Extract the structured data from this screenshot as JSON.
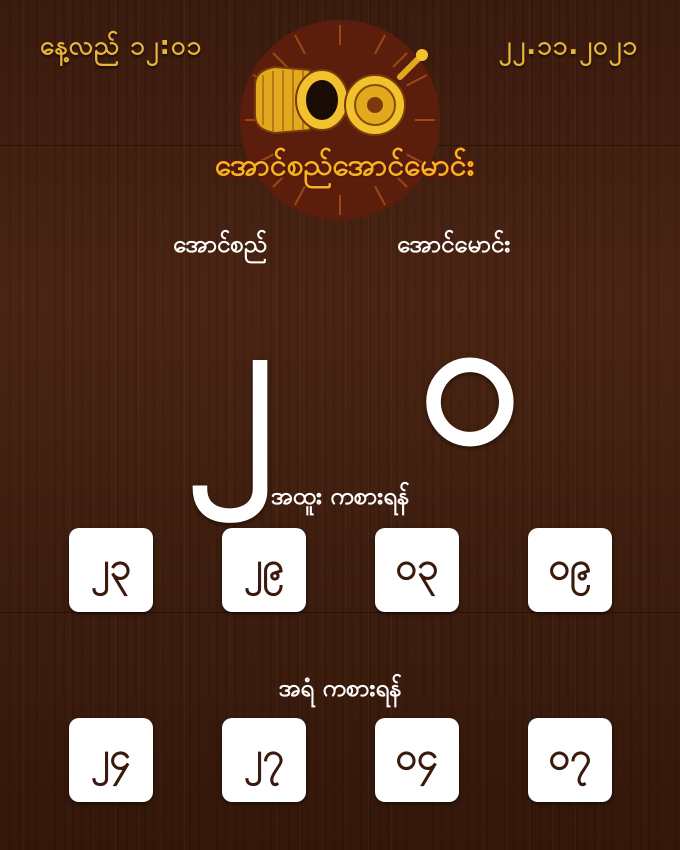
{
  "header": {
    "time": "နေ့လည် ၁၂:၀၁",
    "date": "၂၂.၁၁.၂၀၂၁",
    "logo_text": "အောင်စည်အောင်မောင်း"
  },
  "teams": {
    "left": "အောင်စည်",
    "right": "အောင်မောင်း"
  },
  "scores": {
    "left": "၂",
    "right": "၀"
  },
  "section1": {
    "label": "အထူး ကစားရန်",
    "numbers": [
      "၂၃",
      "၂၉",
      "၀၃",
      "၀၉"
    ]
  },
  "section2": {
    "label": "အရံ ကစားရန်",
    "numbers": [
      "၂၄",
      "၂၇",
      "၀၄",
      "၀၇"
    ]
  },
  "colors": {
    "accent": "#e9b43c",
    "background": "#3f1f0f",
    "box": "#ffffff",
    "box_text": "#3b1a0e"
  }
}
